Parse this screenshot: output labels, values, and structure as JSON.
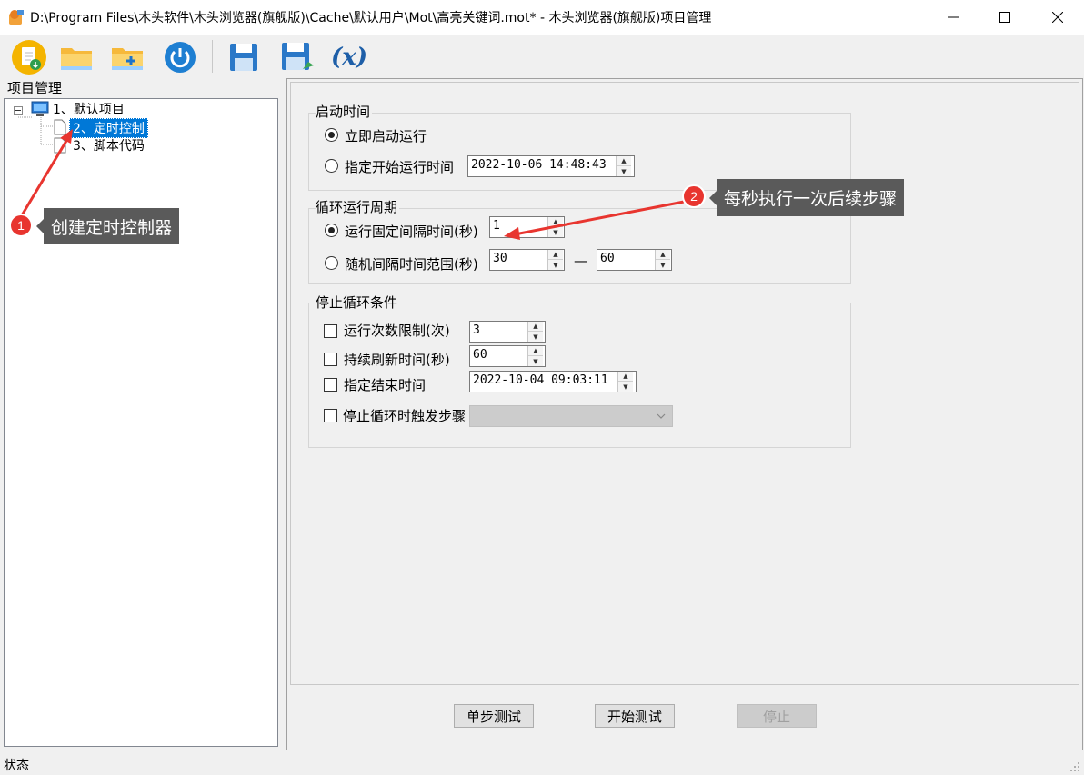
{
  "window": {
    "title": "D:\\Program Files\\木头软件\\木头浏览器(旗舰版)\\Cache\\默认用户\\Mot\\高亮关键词.mot* - 木头浏览器(旗舰版)项目管理"
  },
  "toolbar": {
    "buttons": [
      "new-project-icon",
      "open-folder-icon",
      "add-folder-icon",
      "power-icon",
      "save-icon",
      "save-as-icon",
      "variable-icon"
    ],
    "variable_label": "(x)"
  },
  "left_panel": {
    "title": "项目管理",
    "tree": [
      {
        "label": "1、默认项目",
        "icon": "project-computer-icon"
      },
      {
        "label": "2、定时控制",
        "icon": "document-icon",
        "selected": true
      },
      {
        "label": "3、脚本代码",
        "icon": "document-icon"
      }
    ]
  },
  "start_group": {
    "legend": "启动时间",
    "option_immediate": "立即启动运行",
    "option_scheduled": "指定开始运行时间",
    "scheduled_value": "2022-10-06 14:48:43",
    "selected": "immediate"
  },
  "cycle_group": {
    "legend": "循环运行周期",
    "option_fixed": "运行固定间隔时间(秒)",
    "fixed_value": "1",
    "option_random": "随机间隔时间范围(秒)",
    "random_min": "30",
    "range_dash": "—",
    "random_max": "60",
    "selected": "fixed"
  },
  "stop_group": {
    "legend": "停止循环条件",
    "run_count_label": "运行次数限制(次)",
    "run_count_value": "3",
    "refresh_label": "持续刷新时间(秒)",
    "refresh_value": "60",
    "end_time_label": "指定结束时间",
    "end_time_value": "2022-10-04 09:03:11",
    "trigger_label": "停止循环时触发步骤",
    "trigger_value": ""
  },
  "buttons": {
    "step_test": "单步测试",
    "start_test": "开始测试",
    "stop": "停止"
  },
  "callouts": {
    "one_number": "1",
    "one_text": "创建定时控制器",
    "two_number": "2",
    "two_text": "每秒执行一次后续步骤"
  },
  "status": {
    "label": "状态"
  },
  "colors": {
    "accent_red": "#e8352f",
    "selection_blue": "#0078d7",
    "tooltip_gray": "#5a5a5a"
  }
}
